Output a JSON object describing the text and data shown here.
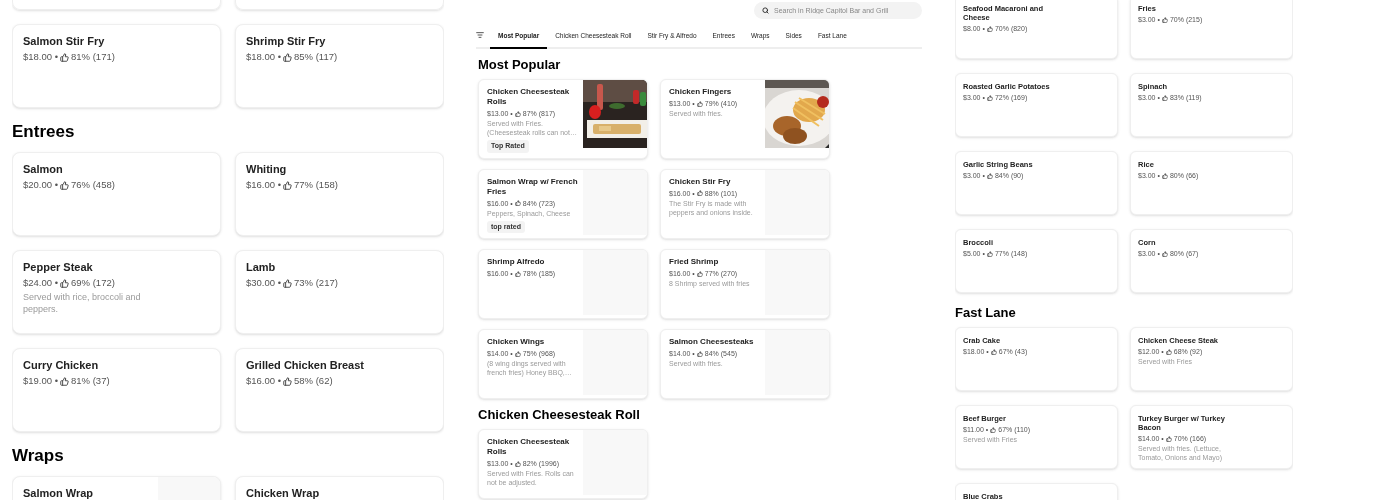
{
  "left_column": {
    "sections": [
      {
        "items": [
          {
            "kind": "cut_off"
          },
          {
            "kind": "cut_off"
          },
          {
            "kind": "item",
            "name": "Salmon Stir Fry",
            "price": "$18.00 •",
            "rating": "81% (171)"
          },
          {
            "kind": "item",
            "name": "Shrimp Stir Fry",
            "price": "$18.00 •",
            "rating": "85% (117)"
          }
        ]
      },
      {
        "heading": "Entrees",
        "items": [
          {
            "kind": "item",
            "name": "Salmon",
            "price": "$20.00 •",
            "rating": "76% (458)"
          },
          {
            "kind": "item",
            "name": "Whiting",
            "price": "$16.00 •",
            "rating": "77% (158)"
          },
          {
            "kind": "item",
            "name": "Pepper Steak",
            "price": "$24.00 •",
            "rating": "69% (172)",
            "description": "Served with rice, broccoli and peppers."
          },
          {
            "kind": "item",
            "name": "Lamb",
            "price": "$30.00 •",
            "rating": "73% (217)"
          },
          {
            "kind": "item",
            "name": "Curry Chicken",
            "price": "$19.00 •",
            "rating": "81% (37)"
          },
          {
            "kind": "item",
            "name": "Grilled Chicken Breast",
            "price": "$16.00 •",
            "rating": "58% (62)"
          }
        ]
      },
      {
        "heading": "Wraps",
        "items": [
          {
            "kind": "item",
            "name": "Salmon Wrap",
            "image": {
              "kind": "placeholder"
            }
          },
          {
            "kind": "item",
            "name": "Chicken Wrap"
          }
        ]
      }
    ]
  },
  "middle_column": {
    "search": {
      "placeholder": "Search in Ridge Capitol Bar and Grill"
    },
    "tabs": [
      {
        "label": "Most Popular",
        "selected": true
      },
      {
        "label": "Chicken Cheesesteak Roll",
        "selected": false
      },
      {
        "label": "Stir Fry & Alfredo",
        "selected": false
      },
      {
        "label": "Entrees",
        "selected": false
      },
      {
        "label": "Wraps",
        "selected": false
      },
      {
        "label": "Sides",
        "selected": false
      },
      {
        "label": "Fast Lane",
        "selected": false
      }
    ],
    "sections": [
      {
        "heading": "Most Popular",
        "items": [
          {
            "kind": "item",
            "name": "Chicken Cheesesteak Rolls",
            "price": "$13.00 •",
            "rating": "87% (817)",
            "description": "Served with Fries. (Cheesesteak rolls can not…",
            "badge": "Top Rated"
          },
          {
            "kind": "item",
            "name": "Chicken Fingers",
            "price": "$13.00 •",
            "rating": "79% (410)",
            "description": "Served with fries."
          },
          {
            "kind": "item",
            "name": "Salmon Wrap w/ French Fries",
            "price": "$16.00 •",
            "rating": "84% (723)",
            "description": "Peppers, Spinach, Cheese",
            "badge": "top rated",
            "image": {
              "kind": "placeholder"
            }
          },
          {
            "kind": "item",
            "name": "Chicken Stir Fry",
            "price": "$16.00 •",
            "rating": "88% (101)",
            "description": "The Stir Fry is made with peppers and onions inside.",
            "image": {
              "kind": "placeholder"
            }
          },
          {
            "kind": "item",
            "name": "Shrimp Alfredo",
            "price": "$16.00 •",
            "rating": "78% (185)",
            "image": {
              "kind": "placeholder"
            }
          },
          {
            "kind": "item",
            "name": "Fried Shrimp",
            "price": "$16.00 •",
            "rating": "77% (270)",
            "description": "8 Shrimp served with fries",
            "image": {
              "kind": "placeholder"
            }
          },
          {
            "kind": "item",
            "name": "Chicken Wings",
            "price": "$14.00 •",
            "rating": "75% (968)",
            "description": "(8 wing dings served with french fries) Honey BBQ,…",
            "image": {
              "kind": "placeholder"
            }
          },
          {
            "kind": "item",
            "name": "Salmon Cheesesteaks",
            "price": "$14.00 •",
            "rating": "84% (545)",
            "description": "Served with fries.",
            "image": {
              "kind": "placeholder"
            }
          }
        ]
      },
      {
        "heading": "Chicken Cheesesteak Roll",
        "items": [
          {
            "kind": "item",
            "name": "Chicken Cheesesteak Rolls",
            "price": "$13.00 •",
            "rating": "82% (1996)",
            "description": "Served with Fries. Rolls can not be adjusted.",
            "image": {
              "kind": "placeholder"
            }
          }
        ]
      }
    ]
  },
  "right_column": {
    "sections": [
      {
        "items": [
          {
            "kind": "item",
            "name": "Seafood Macaroni and Cheese",
            "price": "$8.00 •",
            "rating": "70% (820)"
          },
          {
            "kind": "item",
            "name": "Fries",
            "price": "$3.00 •",
            "rating": "70% (215)"
          },
          {
            "kind": "item",
            "name": "Roasted Garlic Potatoes",
            "price": "$3.00 •",
            "rating": "72% (169)"
          },
          {
            "kind": "item",
            "name": "Spinach",
            "price": "$3.00 •",
            "rating": "83% (119)"
          },
          {
            "kind": "item",
            "name": "Garlic String Beans",
            "price": "$3.00 •",
            "rating": "84% (90)"
          },
          {
            "kind": "item",
            "name": "Rice",
            "price": "$3.00 •",
            "rating": "80% (66)"
          },
          {
            "kind": "item",
            "name": "Broccoli",
            "price": "$5.00 •",
            "rating": "77% (148)"
          },
          {
            "kind": "item",
            "name": "Corn",
            "price": "$3.00 •",
            "rating": "80% (67)"
          }
        ]
      },
      {
        "heading": "Fast Lane",
        "items": [
          {
            "kind": "item",
            "name": "Crab Cake",
            "price": "$18.00 •",
            "rating": "67% (43)"
          },
          {
            "kind": "item",
            "name": "Chicken Cheese Steak",
            "price": "$12.00 •",
            "rating": "68% (92)",
            "description": "Served with Fries"
          },
          {
            "kind": "item",
            "name": "Beef Burger",
            "price": "$11.00 •",
            "rating": "67% (110)",
            "description": "Served with Fries"
          },
          {
            "kind": "item",
            "name": "Turkey Burger w/ Turkey Bacon",
            "price": "$14.00 •",
            "rating": "70% (166)",
            "description": "Served with fries. (Lettuce, Tomato, Onions and Mayo)"
          },
          {
            "kind": "item",
            "name": "Blue Crabs"
          }
        ]
      }
    ]
  }
}
